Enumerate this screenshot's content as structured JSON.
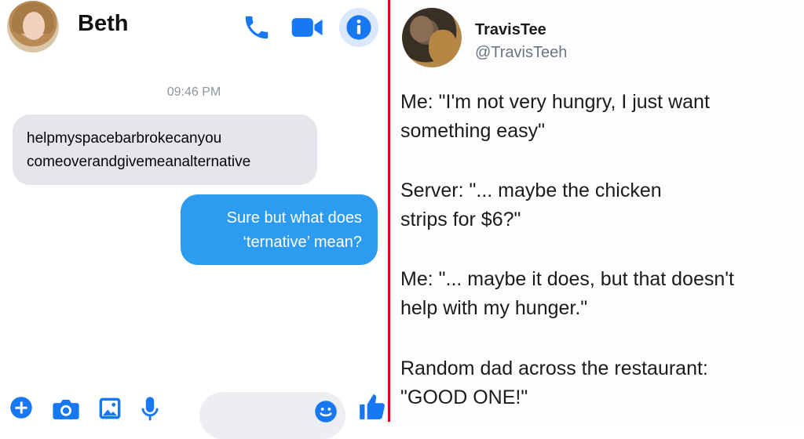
{
  "messenger": {
    "contact_name": "Beth",
    "timestamp": "09:46 PM",
    "incoming": {
      "line1": "helpmyspacebarbrokecanyou",
      "line2": "comeoverandgivemeanalternative"
    },
    "outgoing": {
      "line1": "Sure but what does",
      "line2": "‘ternative’ mean?"
    },
    "icons": {
      "header": [
        "phone-icon",
        "video-camera-icon",
        "info-icon"
      ],
      "bottom": [
        "plus-icon",
        "camera-icon",
        "gallery-icon",
        "microphone-icon",
        "emoji-icon",
        "thumbs-up-icon"
      ]
    },
    "accent_color": "#1877f2",
    "bubble_color": "#2d9bf0"
  },
  "tweet": {
    "name": "TravisTee",
    "handle": "@TravisTeeh",
    "paragraphs": [
      {
        "line1": "Me: \"I'm not very hungry, I just want",
        "line2": "something easy\""
      },
      {
        "line1": "Server: \"... maybe the chicken",
        "line2": "strips for $6?\""
      },
      {
        "line1": "Me: \"... maybe it does, but that doesn't",
        "line2": "help with my hunger.\""
      },
      {
        "line1": "Random dad across the restaurant:",
        "line2": "\"GOOD ONE!\""
      }
    ]
  },
  "divider_color": "#e0001b"
}
